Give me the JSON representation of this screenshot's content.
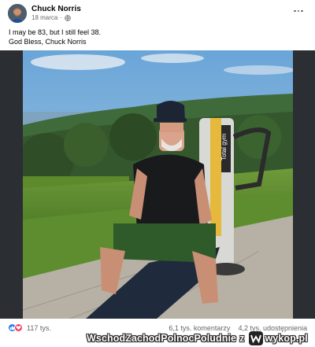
{
  "post": {
    "author": "Chuck Norris",
    "date": "18 marca",
    "text_line1": "I may be 83, but I still feel 38.",
    "text_line2": "God Bless, Chuck Norris",
    "gym_brand": "Total gym"
  },
  "stats": {
    "reactions": "117 tys.",
    "comments": "6,1 tys. komentarzy",
    "shares": "4,2 tys. udostępnienia"
  },
  "watermark": {
    "text": "WschodZachodPolnocPoludnie",
    "sep": "z",
    "logo": "wykop.pl"
  },
  "colors": {
    "brand_blue": "#1877f2",
    "love_red": "#f33e58",
    "meta_gray": "#65676b"
  }
}
